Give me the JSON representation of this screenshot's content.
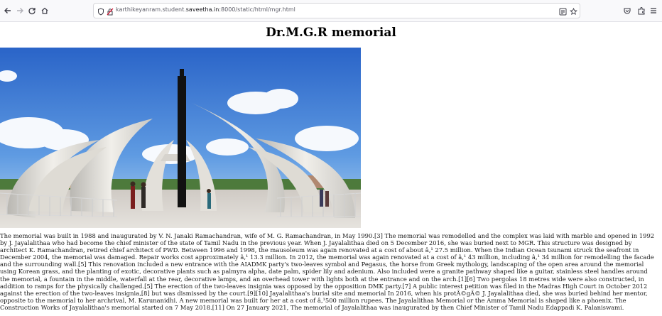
{
  "browser": {
    "url_prefix": "karthikeyanram.student.",
    "url_domain": "saveetha.in",
    "url_suffix": ":8000/static/html/mgr.html"
  },
  "page": {
    "title": "Dr.M.G.R memorial",
    "paragraph": "The memorial was built in 1988 and inaugurated by V. N. Janaki Ramachandran, wife of M. G. Ramachandran, in May 1990.[3] The memorial was remodelled and the complex was laid with marble and opened in 1992 by J. Jayalalithaa who had become the chief minister of the state of Tamil Nadu in the previous year. When J. Jayalalithaa died on 5 December 2016, she was buried next to MGR. This structure was designed by architect K. Ramachandran, retired chief architect of PWD. Between 1996 and 1998, the mausoleum was again renovated at a cost of about â‚¹ 27.5 million. When the Indian Ocean tsunami struck the seafront in December 2004, the memorial was damaged. Repair works cost approximately â‚¹ 13.3 million. In 2012, the memorial was again renovated at a cost of â‚¹ 43 million, including â‚¹ 34 million for remodelling the facade and the surrounding wall.[5] This renovation included a new entrance with the AIADMK party's two-leaves symbol and Pegasus, the horse from Greek mythology, landscaping of the open area around the memorial using Korean grass, and the planting of exotic, decorative plants such as palmyra alpha, date palm, spider lily and adenium. Also included were a granite pathway shaped like a guitar, stainless steel handles around the memorial, a fountain in the middle, waterfall at the rear, decorative lamps, and an overhead tower with lights both at the entrance and on the arch.[1][6] Two pergolas 18 metres wide were also constructed, in addition to ramps for the physically challenged.[5] The erection of the two-leaves insignia was opposed by the opposition DMK party.[7] A public interest petition was filed in the Madras High Court in October 2012 against the erection of the two-leaves insignia,[8] but was dismissed by the court.[9][10] Jayalalithaa's burial site and memorial In 2016, when his protÃ©gÃ© J. Jayalalithaa died, she was buried behind her mentor, opposite to the memorial to her archrival, M. Karunanidhi. A new memorial was built for her at a cost of â‚¹500 million rupees. The Jayalalithaa Memorial or the Amma Memorial is shaped like a phoenix. The Construction Works of Jayalalithaa's memorial started on 7 May 2018.[11] On 27 January 2021, The memorial of Jayalalithaa was inaugurated by then Chief Minister of Tamil Nadu Edappadi K. Palaniswami."
  },
  "icons": {
    "back": "back-arrow-icon",
    "forward": "forward-arrow-icon",
    "reload": "reload-icon",
    "home": "home-icon",
    "site_info": "shield-icon",
    "connection": "insecure-lock-icon",
    "reader": "reader-view-icon",
    "bookmark": "star-icon",
    "pocket": "pocket-icon",
    "extensions": "extensions-icon",
    "menu": "hamburger-menu-icon"
  },
  "colors": {
    "sky_top": "#2f6fd0",
    "sky_bottom": "#9cc6f0",
    "structure": "#e8e6e0",
    "pillar": "#111111"
  }
}
